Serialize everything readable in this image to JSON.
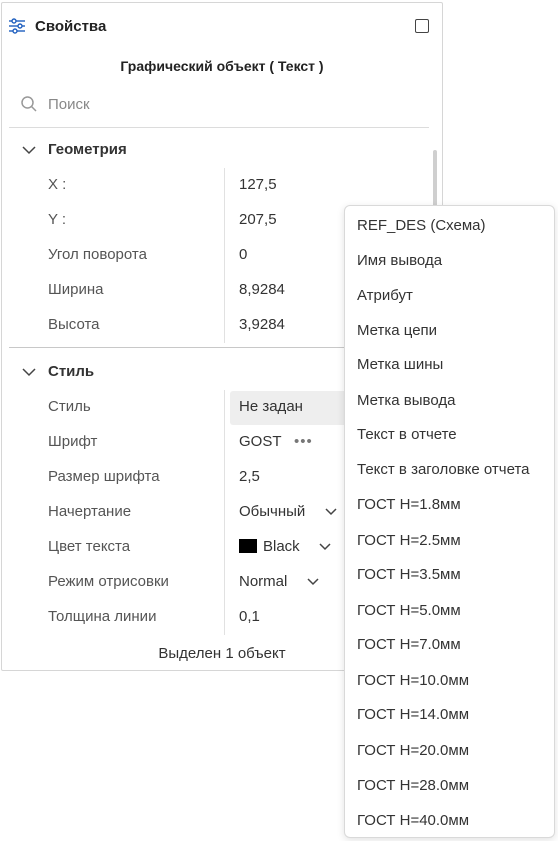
{
  "header": {
    "title": "Свойства",
    "icon": "sliders-icon"
  },
  "object_title": "Графический объект ( Текст )",
  "search": {
    "placeholder": "Поиск"
  },
  "geometry": {
    "label": "Геометрия",
    "rows": [
      {
        "key": "X :",
        "value": "127,5"
      },
      {
        "key": "Y :",
        "value": "207,5"
      },
      {
        "key": "Угол поворота",
        "value": "0"
      },
      {
        "key": "Ширина",
        "value": "8,9284"
      },
      {
        "key": "Высота",
        "value": "3,9284"
      }
    ]
  },
  "style": {
    "label": "Стиль",
    "rows": [
      {
        "key": "Стиль",
        "value": "Не задан"
      },
      {
        "key": "Шрифт",
        "value": "GOST"
      },
      {
        "key": "Размер шрифта",
        "value": "2,5"
      },
      {
        "key": "Начертание",
        "value": "Обычный"
      },
      {
        "key": "Цвет текста",
        "value": "Black",
        "color": "#000000"
      },
      {
        "key": "Режим отрисовки",
        "value": "Normal"
      },
      {
        "key": "Толщина линии",
        "value": "0,1"
      }
    ]
  },
  "footer": "Выделен 1 объект",
  "dropdown": {
    "items": [
      "REF_DES (Схема)",
      "Имя вывода",
      "Атрибут",
      "Метка цепи",
      "Метка шины",
      "Метка вывода",
      "Текст в отчете",
      "Текст в заголовке отчета",
      "ГОСТ H=1.8мм",
      "ГОСТ H=2.5мм",
      "ГОСТ H=3.5мм",
      "ГОСТ H=5.0мм",
      "ГОСТ H=7.0мм",
      "ГОСТ H=10.0мм",
      "ГОСТ H=14.0мм",
      "ГОСТ H=20.0мм",
      "ГОСТ H=28.0мм",
      "ГОСТ H=40.0мм"
    ]
  }
}
